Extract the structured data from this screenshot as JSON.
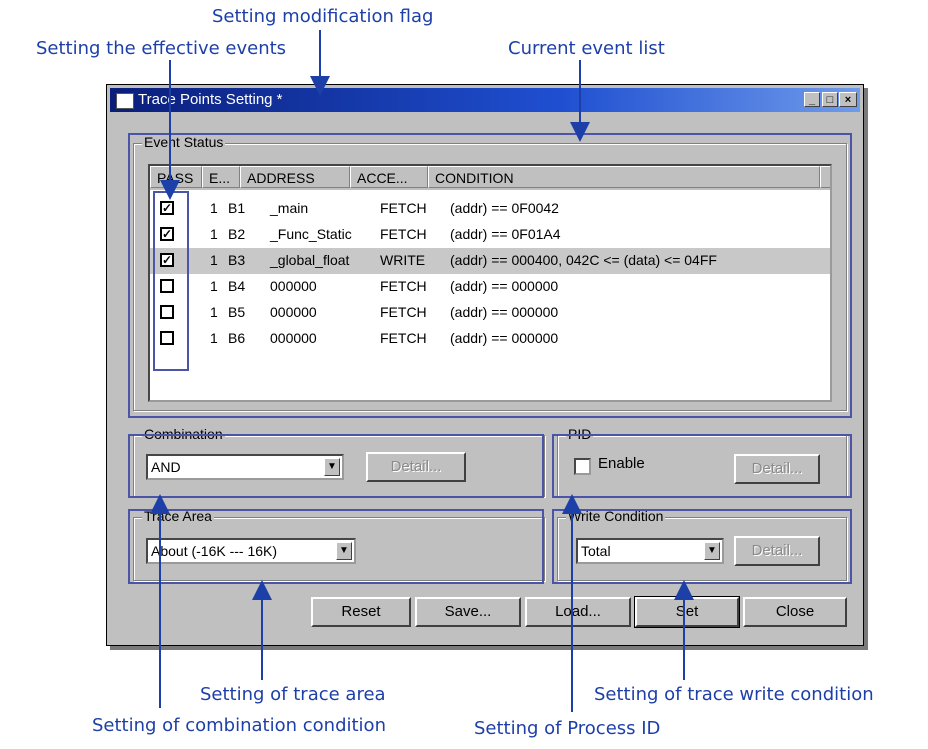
{
  "annotations": {
    "modification_flag": "Setting modification flag",
    "effective_events": "Setting the effective events",
    "current_event_list": "Current event list",
    "trace_area": "Setting of trace area",
    "trace_write_condition": "Setting of trace write condition",
    "combination_condition": "Setting of combination condition",
    "process_id": "Setting of Process ID"
  },
  "window": {
    "title": "Trace Points Setting *",
    "minimize": "_",
    "maximize": "□",
    "close": "×"
  },
  "event_status": {
    "label": "Event Status",
    "columns": [
      "PASS",
      "E...",
      "ADDRESS",
      "ACCE...",
      "CONDITION"
    ],
    "rows": [
      {
        "checked": true,
        "pass": "1",
        "event": "B1",
        "address": "_main",
        "access": "FETCH",
        "condition": "(addr) == 0F0042"
      },
      {
        "checked": true,
        "pass": "1",
        "event": "B2",
        "address": "_Func_Static",
        "access": "FETCH",
        "condition": "(addr) == 0F01A4"
      },
      {
        "checked": true,
        "pass": "1",
        "event": "B3",
        "address": "_global_float",
        "access": "WRITE",
        "condition": "(addr) == 000400, 042C <= (data) <= 04FF"
      },
      {
        "checked": false,
        "pass": "1",
        "event": "B4",
        "address": "000000",
        "access": "FETCH",
        "condition": "(addr) == 000000"
      },
      {
        "checked": false,
        "pass": "1",
        "event": "B5",
        "address": "000000",
        "access": "FETCH",
        "condition": "(addr) == 000000"
      },
      {
        "checked": false,
        "pass": "1",
        "event": "B6",
        "address": "000000",
        "access": "FETCH",
        "condition": "(addr) == 000000"
      }
    ]
  },
  "combination": {
    "label": "Combination",
    "value": "AND",
    "detail": "Detail..."
  },
  "pid": {
    "label": "PID",
    "enable": "Enable",
    "detail": "Detail..."
  },
  "trace_area": {
    "label": "Trace Area",
    "value": "About (-16K --- 16K)"
  },
  "write_condition": {
    "label": "Write Condition",
    "value": "Total",
    "detail": "Detail..."
  },
  "buttons": {
    "reset": "Reset",
    "save": "Save...",
    "load": "Load...",
    "set": "Set",
    "close": "Close"
  }
}
